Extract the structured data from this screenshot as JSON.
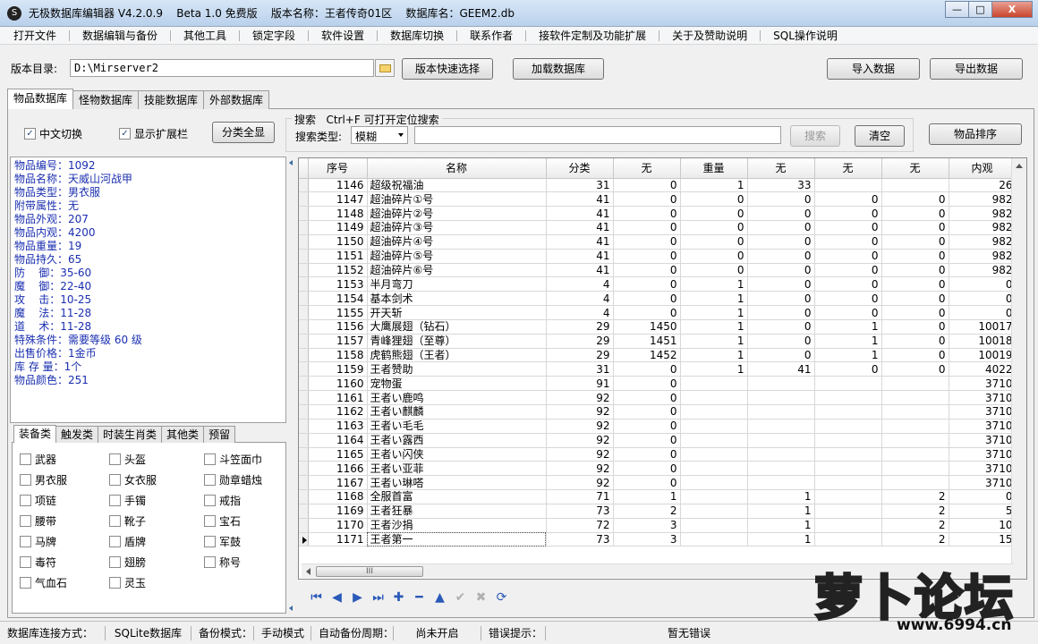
{
  "window": {
    "title": "无极数据库编辑器 V4.2.0.9    Beta 1.0 免费版    版本名称：王者传奇01区    数据库名：GEEM2.db",
    "minimize": "—",
    "maximize": "□",
    "close": "X"
  },
  "menu": [
    "打开文件",
    "数据编辑与备份",
    "其他工具",
    "锁定字段",
    "软件设置",
    "数据库切换",
    "联系作者",
    "接软件定制及功能扩展",
    "关于及赞助说明",
    "SQL操作说明"
  ],
  "version_row": {
    "label": "版本目录:",
    "path": "D:\\Mirserver2",
    "quick_select": "版本快速选择",
    "load_db": "加载数据库",
    "import": "导入数据",
    "export": "导出数据"
  },
  "main_tabs": [
    "物品数据库",
    "怪物数据库",
    "技能数据库",
    "外部数据库"
  ],
  "options": {
    "chinese_toggle": "中文切换",
    "show_ext": "显示扩展栏",
    "show_all_categories": "分类全显"
  },
  "search": {
    "legend": "搜索   Ctrl+F 可打开定位搜索",
    "type_label": "搜索类型:",
    "type_value": "模糊",
    "search_button": "搜索",
    "clear_button": "清空",
    "sort_button": "物品排序"
  },
  "info_lines": [
    "物品编号：1092",
    "物品名称：天威山河战甲",
    "物品类型：男衣服",
    "附带属性：无",
    "物品外观：207",
    "物品内观：4200",
    "物品重量：19",
    "物品持久：65",
    "防    御：35-60",
    "魔    御：22-40",
    "攻    击：10-25",
    "魔    法：11-28",
    "道    术：11-28",
    "特殊条件：需要等级 60 级",
    "出售价格：1金币",
    "库 存 量：1个",
    "物品颜色：251"
  ],
  "category_tabs": [
    "装备类",
    "触发类",
    "时装生肖类",
    "其他类",
    "预留"
  ],
  "categories": [
    "武器",
    "头盔",
    "斗笠面巾",
    "男衣服",
    "女衣服",
    "勋章蜡烛",
    "项链",
    "手镯",
    "戒指",
    "腰带",
    "靴子",
    "宝石",
    "马牌",
    "盾牌",
    "军鼓",
    "毒符",
    "翅膀",
    "称号",
    "气血石",
    "灵玉"
  ],
  "grid": {
    "columns": [
      "序号",
      "名称",
      "分类",
      "无",
      "重量",
      "无",
      "无",
      "无",
      "内观"
    ],
    "rows": [
      [
        "1146",
        "超级祝福油",
        "31",
        "0",
        "1",
        "33",
        "",
        "",
        "26"
      ],
      [
        "1147",
        "超油碎片①号",
        "41",
        "0",
        "0",
        "0",
        "0",
        "0",
        "982"
      ],
      [
        "1148",
        "超油碎片②号",
        "41",
        "0",
        "0",
        "0",
        "0",
        "0",
        "982"
      ],
      [
        "1149",
        "超油碎片③号",
        "41",
        "0",
        "0",
        "0",
        "0",
        "0",
        "982"
      ],
      [
        "1150",
        "超油碎片④号",
        "41",
        "0",
        "0",
        "0",
        "0",
        "0",
        "982"
      ],
      [
        "1151",
        "超油碎片⑤号",
        "41",
        "0",
        "0",
        "0",
        "0",
        "0",
        "982"
      ],
      [
        "1152",
        "超油碎片⑥号",
        "41",
        "0",
        "0",
        "0",
        "0",
        "0",
        "982"
      ],
      [
        "1153",
        "半月弯刀",
        "4",
        "0",
        "1",
        "0",
        "0",
        "0",
        "0"
      ],
      [
        "1154",
        "基本剑术",
        "4",
        "0",
        "1",
        "0",
        "0",
        "0",
        "0"
      ],
      [
        "1155",
        "开天斩",
        "4",
        "0",
        "1",
        "0",
        "0",
        "0",
        "0"
      ],
      [
        "1156",
        "大鹰展翅（钻石）",
        "29",
        "1450",
        "1",
        "0",
        "1",
        "0",
        "10017"
      ],
      [
        "1157",
        "青峰狸翅（至尊）",
        "29",
        "1451",
        "1",
        "0",
        "1",
        "0",
        "10018"
      ],
      [
        "1158",
        "虎鹤熊翅（王者）",
        "29",
        "1452",
        "1",
        "0",
        "1",
        "0",
        "10019"
      ],
      [
        "1159",
        "王者赞助",
        "31",
        "0",
        "1",
        "41",
        "0",
        "0",
        "4022"
      ],
      [
        "1160",
        "宠物蛋",
        "91",
        "0",
        "",
        "",
        "",
        "",
        "3710"
      ],
      [
        "1161",
        "王者い鹿鸣",
        "92",
        "0",
        "",
        "",
        "",
        "",
        "3710"
      ],
      [
        "1162",
        "王者い麒麟",
        "92",
        "0",
        "",
        "",
        "",
        "",
        "3710"
      ],
      [
        "1163",
        "王者い毛毛",
        "92",
        "0",
        "",
        "",
        "",
        "",
        "3710"
      ],
      [
        "1164",
        "王者い露西",
        "92",
        "0",
        "",
        "",
        "",
        "",
        "3710"
      ],
      [
        "1165",
        "王者い闪侠",
        "92",
        "0",
        "",
        "",
        "",
        "",
        "3710"
      ],
      [
        "1166",
        "王者い亚菲",
        "92",
        "0",
        "",
        "",
        "",
        "",
        "3710"
      ],
      [
        "1167",
        "王者い琳嗒",
        "92",
        "0",
        "",
        "",
        "",
        "",
        "3710"
      ],
      [
        "1168",
        "全服首富",
        "71",
        "1",
        "",
        "1",
        "",
        "2",
        "0"
      ],
      [
        "1169",
        "王者狂暴",
        "73",
        "2",
        "",
        "1",
        "",
        "2",
        "5"
      ],
      [
        "1170",
        "王者沙捐",
        "72",
        "3",
        "",
        "1",
        "",
        "2",
        "10"
      ],
      [
        "1171",
        "王者第一",
        "73",
        "3",
        "",
        "1",
        "",
        "2",
        "15"
      ]
    ]
  },
  "scroll_thumb": "III",
  "navigator": [
    "⏮",
    "◀",
    "▶",
    "⏭",
    "✚",
    "━",
    "▲",
    "✔",
    "✖",
    "⟳"
  ],
  "status": [
    "数据库连接方式：",
    "SQLite数据库",
    "备份模式：",
    "手动模式",
    "自动备份周期：",
    "尚未开启",
    "错误提示：",
    "暂无错误"
  ],
  "logo": {
    "text": "萝卜论坛",
    "url": "www.6994.cn"
  }
}
